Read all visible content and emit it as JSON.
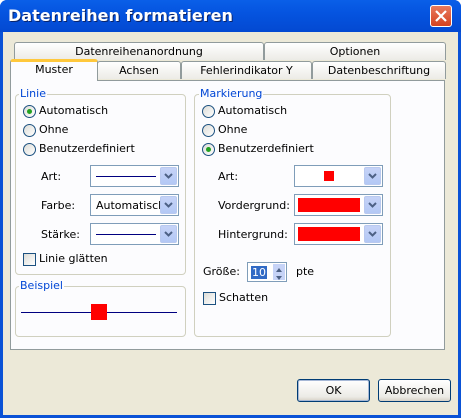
{
  "window": {
    "title": "Datenreihen formatieren"
  },
  "tabs_back": [
    {
      "label": "Datenreihenanordnung"
    },
    {
      "label": "Optionen"
    }
  ],
  "tabs_front": [
    {
      "label": "Muster"
    },
    {
      "label": "Achsen"
    },
    {
      "label": "Fehlerindikator Y"
    },
    {
      "label": "Datenbeschriftung"
    }
  ],
  "linie": {
    "legend": "Linie",
    "options": [
      "Automatisch",
      "Ohne",
      "Benutzerdefiniert"
    ],
    "selected": "Automatisch",
    "art_label": "Art:",
    "farbe_label": "Farbe:",
    "farbe_value": "Automatisch",
    "staerke_label": "Stärke:",
    "glaetten_label": "Linie glätten"
  },
  "beispiel": {
    "legend": "Beispiel"
  },
  "markierung": {
    "legend": "Markierung",
    "options": [
      "Automatisch",
      "Ohne",
      "Benutzerdefiniert"
    ],
    "selected": "Benutzerdefiniert",
    "art_label": "Art:",
    "vordergrund_label": "Vordergrund:",
    "hintergrund_label": "Hintergrund:",
    "groesse_label": "Größe:",
    "groesse_value": "10",
    "groesse_unit": "pte",
    "schatten_label": "Schatten"
  },
  "buttons": {
    "ok": "OK",
    "cancel": "Abbrechen"
  },
  "colors": {
    "marker": "#ff0000",
    "line": "#000080",
    "accent": "#0046d5"
  }
}
